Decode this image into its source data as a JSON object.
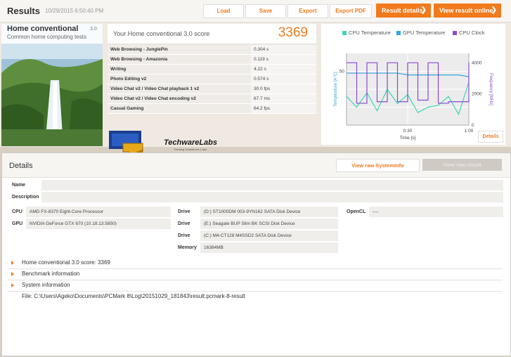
{
  "header": {
    "title": "Results",
    "date": "10/29/2015 6:50:40 PM",
    "buttons": {
      "load": "Load",
      "save": "Save",
      "export": "Export",
      "export_pdf": "Export PDF"
    },
    "result_details": "Result details",
    "view_online": "View result online"
  },
  "benchmark": {
    "name": "Home conventional",
    "version": "3.0",
    "subtitle": "Common home computing tests",
    "score_label": "Your Home conventional 3.0 score",
    "score": "3369",
    "results": [
      {
        "name": "Web Browsing - JunglePin",
        "value": "0.304 s"
      },
      {
        "name": "Web Browsing - Amazonia",
        "value": "0.119 s"
      },
      {
        "name": "Writing",
        "value": "4.22 s"
      },
      {
        "name": "Photo Editing v2",
        "value": "0.574 s"
      },
      {
        "name": "Video Chat v2 / Video Chat playback 1 v2",
        "value": "30.0 fps"
      },
      {
        "name": "Video Chat v2 / Video Chat encoding v2",
        "value": "67.7 ms"
      },
      {
        "name": "Casual Gaming",
        "value": "64.2 fps"
      }
    ]
  },
  "watermark": {
    "name": "TechwareLabs",
    "tagline": "Thinking Outside the Cube"
  },
  "chart_data": {
    "type": "line",
    "x": [
      0,
      5,
      10,
      15,
      20,
      25,
      30,
      35,
      40,
      45,
      50,
      55,
      60
    ],
    "xticks": [
      "0:30",
      "1:00"
    ],
    "xlabel": "Time [s]",
    "ylabel_left": "Temperature [A°C]",
    "ylabel_right": "Frequency [MHz]",
    "yticks_left": [
      "50"
    ],
    "yticks_right": [
      "4000",
      "2000",
      "0"
    ],
    "series": [
      {
        "name": "CPU Temperature",
        "color": "#3ed6b4",
        "values": [
          36,
          30,
          38,
          28,
          40,
          32,
          37,
          27,
          30,
          31,
          36,
          26,
          44
        ]
      },
      {
        "name": "GPU Temperature",
        "color": "#2fa6dc",
        "values": [
          49,
          49,
          49,
          49,
          49,
          49,
          48,
          48,
          48,
          48,
          48,
          48,
          47
        ]
      },
      {
        "name": "CPU Clock",
        "color": "#8a4ad0",
        "values": [
          4000,
          1400,
          4000,
          1500,
          4000,
          1500,
          4000,
          1600,
          4000,
          1400,
          1500,
          1500,
          4000
        ]
      }
    ],
    "details_label": "Details"
  },
  "details": {
    "title": "Details",
    "view_raw_systeminfo": "View raw SystemInfo",
    "view_raw_result": "View raw result",
    "name_label": "Name",
    "name_value": "",
    "description_label": "Description",
    "description_value": "",
    "cpu_label": "CPU",
    "cpu_value": "AMD FX-8370 Eight-Core Processor",
    "gpu_label": "GPU",
    "gpu_value": "NVIDIA GeForce GTX 670 (10.18.13.5850)",
    "drive_label": "Drive",
    "drives": [
      "(D:) ST1000DM 003-9YN162 SATA Disk Device",
      "(E:) Seagate BUP Slim BK SCSI Disk Device",
      "(C:) M4-CT128 M4SSD2 SATA Disk Device"
    ],
    "memory_label": "Memory",
    "memory_value": "16384MB",
    "opencl_label": "OpenCL",
    "opencl_value": "----",
    "sections": [
      "Home conventional 3.0 score: 3369",
      "Benchmark information",
      "System information"
    ],
    "file": "File: C:\\Users\\Ageko\\Documents\\PCMark 8\\Log\\20151029_181843\\result.pcmark-8-result"
  }
}
